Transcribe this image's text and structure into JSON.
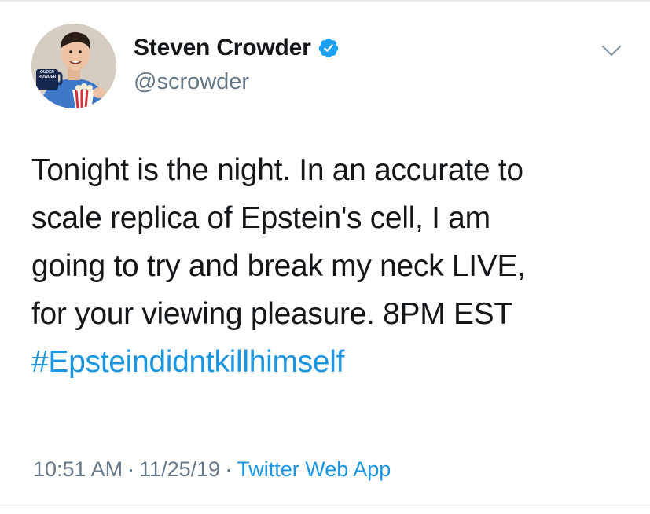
{
  "author": {
    "name": "Steven Crowder",
    "handle": "@scrowder",
    "verified": true,
    "avatar_mug_text": [
      "OUDER",
      "ROWDER"
    ]
  },
  "tweet": {
    "lines": [
      "Tonight is the night. In an accurate to",
      "scale replica of Epstein's cell, I am",
      "going to try and break my neck LIVE,",
      "for your viewing pleasure. 8PM EST"
    ],
    "hashtag": "#Epsteindidntkillhimself"
  },
  "meta": {
    "time": "10:51 AM",
    "separator": "·",
    "date": "11/25/19",
    "source": "Twitter Web App"
  },
  "icons": {
    "verified": "verified-badge-icon",
    "menu": "chevron-down-icon"
  },
  "colors": {
    "link": "#1b95e0",
    "secondary_text": "#657786",
    "primary_text": "#14171a"
  }
}
